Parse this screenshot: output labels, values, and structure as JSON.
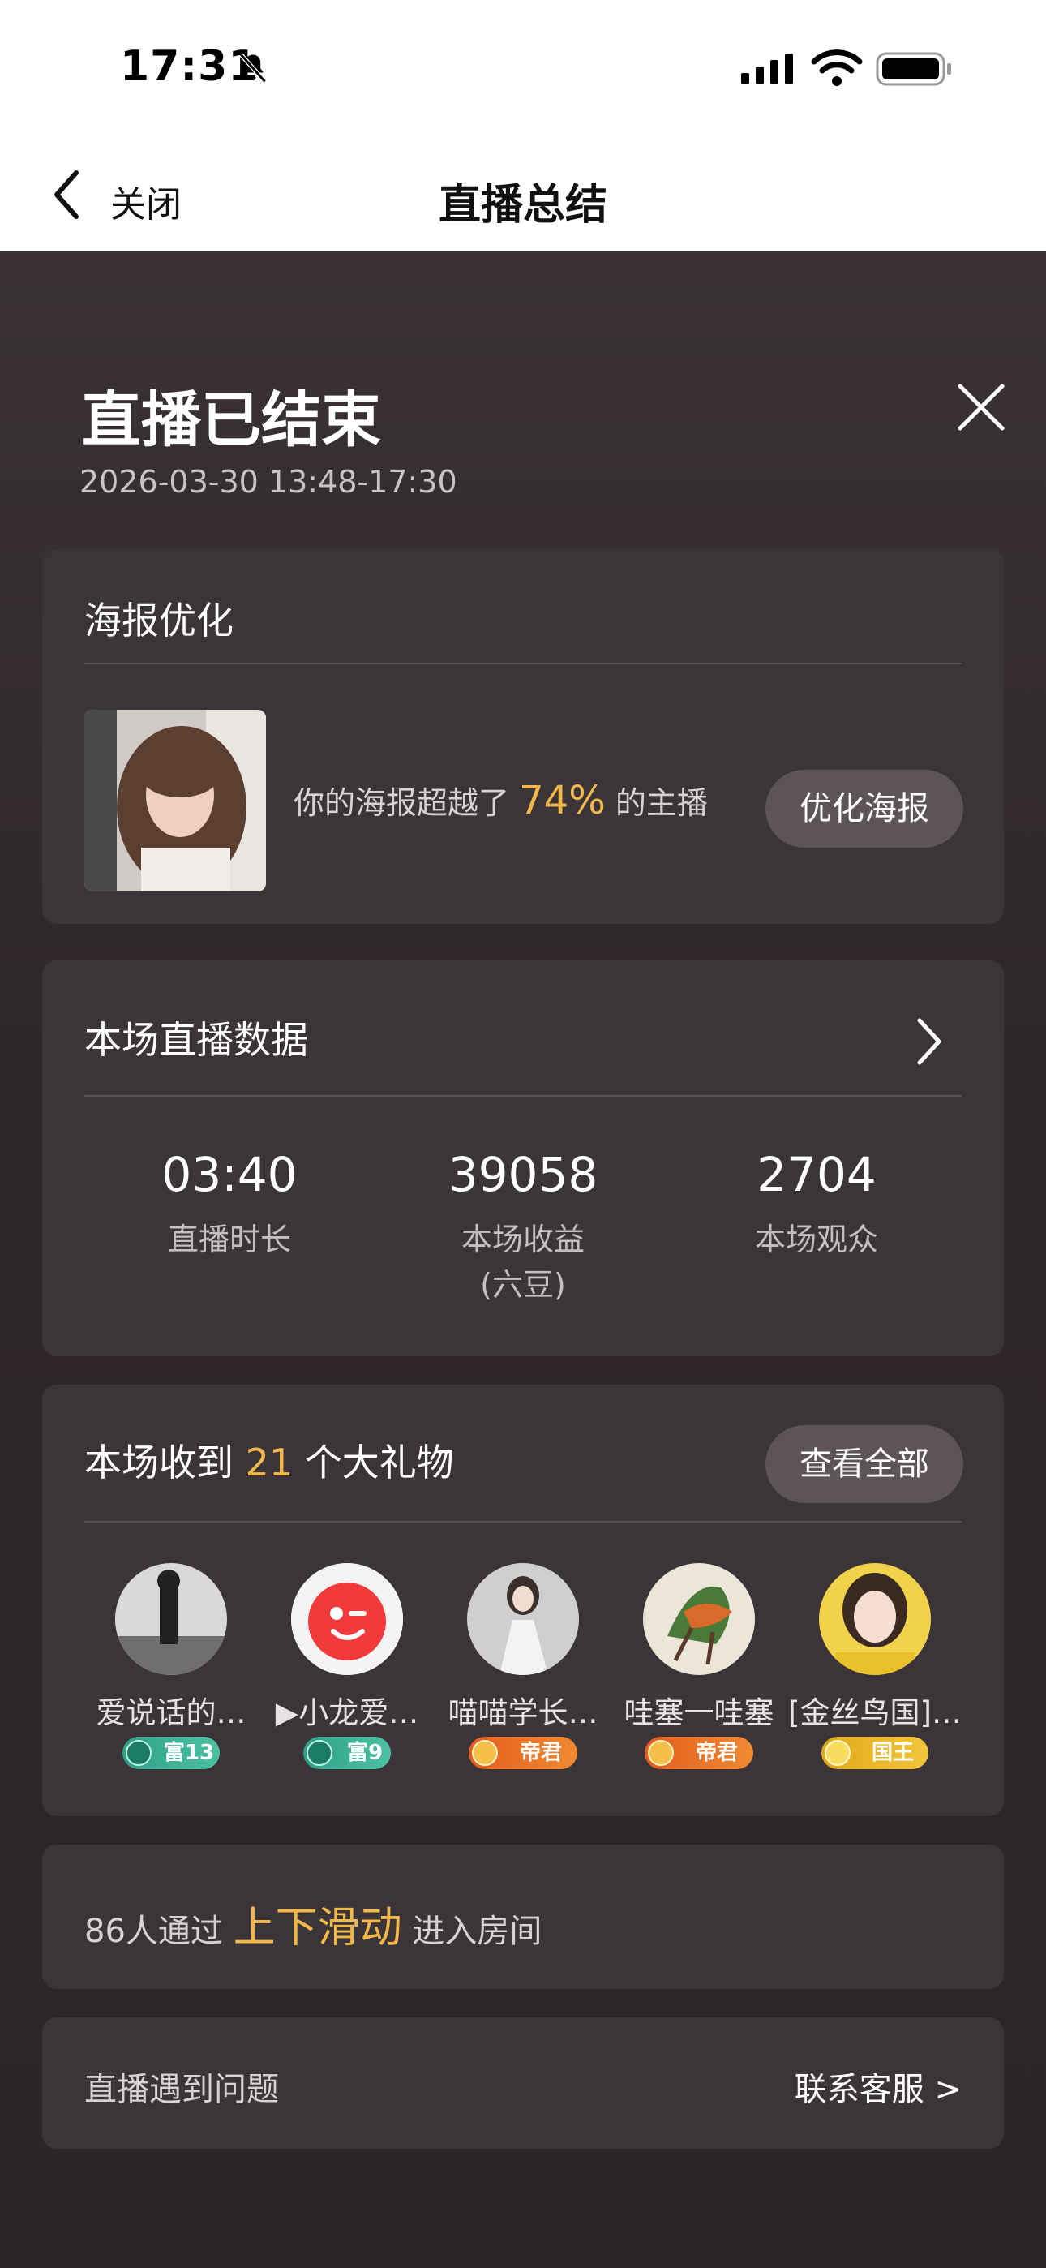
{
  "status_bar": {
    "time": "17:31"
  },
  "nav": {
    "back_label": "关闭",
    "title": "直播总结"
  },
  "summary": {
    "title": "直播已结束",
    "time_range": "2026-03-30 13:48-17:30"
  },
  "poster": {
    "title": "海报优化",
    "text_prefix": "你的海报超越了",
    "percent": "74%",
    "text_suffix": "的主播",
    "button": "优化海报"
  },
  "stats": {
    "title": "本场直播数据",
    "items": [
      {
        "value": "03:40",
        "label": "直播时长"
      },
      {
        "value": "39058",
        "label": "本场收益",
        "sublabel": "(六豆)"
      },
      {
        "value": "2704",
        "label": "本场观众"
      }
    ]
  },
  "gifts": {
    "title_prefix": "本场收到",
    "count": "21",
    "title_suffix": "个大礼物",
    "button": "查看全部",
    "gifters": [
      {
        "name": "爱说话的…",
        "badge": "富13"
      },
      {
        "name": "▶小龙爱…",
        "badge": "富9"
      },
      {
        "name": "喵喵学长…",
        "badge": "帝君"
      },
      {
        "name": "哇塞一哇塞",
        "badge": "帝君"
      },
      {
        "name": "[金丝鸟国]…",
        "badge": "国王"
      }
    ]
  },
  "swipe": {
    "prefix": "86人通过",
    "highlight": "上下滑动",
    "suffix": "进入房间"
  },
  "problem": {
    "text": "直播遇到问题",
    "link": "联系客服 >"
  },
  "colors": {
    "accent": "#f2b94a",
    "card_bg": "#3b3439",
    "page_bg": "#2c2528"
  }
}
